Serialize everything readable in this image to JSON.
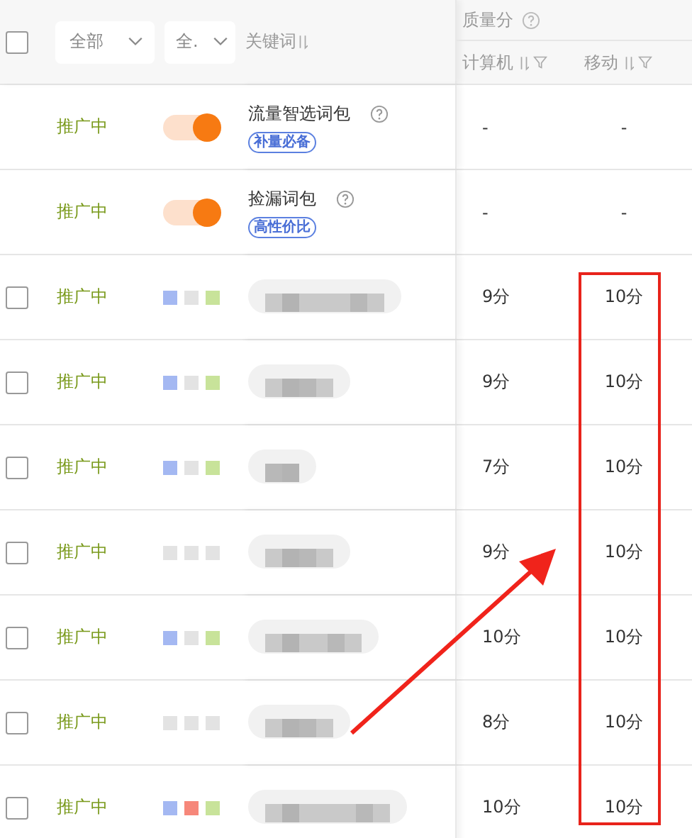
{
  "header": {
    "select_all": {
      "checked": false
    },
    "status_filter": "全部",
    "device_filter": "全.",
    "keyword_label": "关键词",
    "quality_label": "质量分",
    "pc_label": "计算机",
    "mobile_label": "移动"
  },
  "rows": [
    {
      "kind": "package",
      "status": "推广中",
      "on": true,
      "name": "流量智选词包",
      "tag": "补量必备",
      "pc": "-",
      "mobile": "-"
    },
    {
      "kind": "package",
      "status": "推广中",
      "on": true,
      "name": "捡漏词包",
      "tag": "高性价比",
      "pc": "-",
      "mobile": "-"
    },
    {
      "kind": "keyword",
      "checked": false,
      "status": "推广中",
      "devices": [
        {
          "color": "#a4b8f2"
        },
        {
          "color": "#e3e3e3"
        },
        {
          "color": "#c8e39a"
        }
      ],
      "pc": "9分",
      "mobile": "10分"
    },
    {
      "kind": "keyword",
      "checked": false,
      "status": "推广中",
      "devices": [
        {
          "color": "#a4b8f2"
        },
        {
          "color": "#e3e3e3"
        },
        {
          "color": "#c8e39a"
        }
      ],
      "pc": "9分",
      "mobile": "10分"
    },
    {
      "kind": "keyword",
      "checked": false,
      "status": "推广中",
      "devices": [
        {
          "color": "#a4b8f2"
        },
        {
          "color": "#e3e3e3"
        },
        {
          "color": "#c8e39a"
        }
      ],
      "pc": "7分",
      "mobile": "10分"
    },
    {
      "kind": "keyword",
      "checked": false,
      "status": "推广中",
      "devices": [
        {
          "color": "#e3e3e3"
        },
        {
          "color": "#e3e3e3"
        },
        {
          "color": "#e3e3e3"
        }
      ],
      "pc": "9分",
      "mobile": "10分"
    },
    {
      "kind": "keyword",
      "checked": false,
      "status": "推广中",
      "devices": [
        {
          "color": "#a4b8f2"
        },
        {
          "color": "#e3e3e3"
        },
        {
          "color": "#c8e39a"
        }
      ],
      "pc": "10分",
      "mobile": "10分"
    },
    {
      "kind": "keyword",
      "checked": false,
      "status": "推广中",
      "devices": [
        {
          "color": "#e3e3e3"
        },
        {
          "color": "#e3e3e3"
        },
        {
          "color": "#e3e3e3"
        }
      ],
      "pc": "8分",
      "mobile": "10分"
    },
    {
      "kind": "keyword",
      "checked": false,
      "status": "推广中",
      "devices": [
        {
          "color": "#a4b8f2"
        },
        {
          "color": "#f6877a"
        },
        {
          "color": "#c8e39a"
        }
      ],
      "pc": "10分",
      "mobile": "10分"
    }
  ]
}
